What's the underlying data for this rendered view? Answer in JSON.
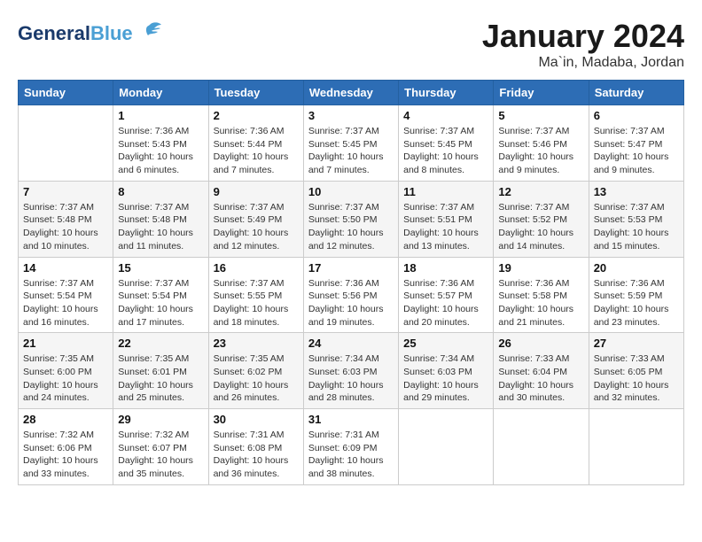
{
  "header": {
    "logo_line1": "General",
    "logo_line2": "Blue",
    "month": "January 2024",
    "location": "Ma`in, Madaba, Jordan"
  },
  "weekdays": [
    "Sunday",
    "Monday",
    "Tuesday",
    "Wednesday",
    "Thursday",
    "Friday",
    "Saturday"
  ],
  "weeks": [
    [
      {
        "day": "",
        "info": ""
      },
      {
        "day": "1",
        "info": "Sunrise: 7:36 AM\nSunset: 5:43 PM\nDaylight: 10 hours\nand 6 minutes."
      },
      {
        "day": "2",
        "info": "Sunrise: 7:36 AM\nSunset: 5:44 PM\nDaylight: 10 hours\nand 7 minutes."
      },
      {
        "day": "3",
        "info": "Sunrise: 7:37 AM\nSunset: 5:45 PM\nDaylight: 10 hours\nand 7 minutes."
      },
      {
        "day": "4",
        "info": "Sunrise: 7:37 AM\nSunset: 5:45 PM\nDaylight: 10 hours\nand 8 minutes."
      },
      {
        "day": "5",
        "info": "Sunrise: 7:37 AM\nSunset: 5:46 PM\nDaylight: 10 hours\nand 9 minutes."
      },
      {
        "day": "6",
        "info": "Sunrise: 7:37 AM\nSunset: 5:47 PM\nDaylight: 10 hours\nand 9 minutes."
      }
    ],
    [
      {
        "day": "7",
        "info": "Sunrise: 7:37 AM\nSunset: 5:48 PM\nDaylight: 10 hours\nand 10 minutes."
      },
      {
        "day": "8",
        "info": "Sunrise: 7:37 AM\nSunset: 5:48 PM\nDaylight: 10 hours\nand 11 minutes."
      },
      {
        "day": "9",
        "info": "Sunrise: 7:37 AM\nSunset: 5:49 PM\nDaylight: 10 hours\nand 12 minutes."
      },
      {
        "day": "10",
        "info": "Sunrise: 7:37 AM\nSunset: 5:50 PM\nDaylight: 10 hours\nand 12 minutes."
      },
      {
        "day": "11",
        "info": "Sunrise: 7:37 AM\nSunset: 5:51 PM\nDaylight: 10 hours\nand 13 minutes."
      },
      {
        "day": "12",
        "info": "Sunrise: 7:37 AM\nSunset: 5:52 PM\nDaylight: 10 hours\nand 14 minutes."
      },
      {
        "day": "13",
        "info": "Sunrise: 7:37 AM\nSunset: 5:53 PM\nDaylight: 10 hours\nand 15 minutes."
      }
    ],
    [
      {
        "day": "14",
        "info": "Sunrise: 7:37 AM\nSunset: 5:54 PM\nDaylight: 10 hours\nand 16 minutes."
      },
      {
        "day": "15",
        "info": "Sunrise: 7:37 AM\nSunset: 5:54 PM\nDaylight: 10 hours\nand 17 minutes."
      },
      {
        "day": "16",
        "info": "Sunrise: 7:37 AM\nSunset: 5:55 PM\nDaylight: 10 hours\nand 18 minutes."
      },
      {
        "day": "17",
        "info": "Sunrise: 7:36 AM\nSunset: 5:56 PM\nDaylight: 10 hours\nand 19 minutes."
      },
      {
        "day": "18",
        "info": "Sunrise: 7:36 AM\nSunset: 5:57 PM\nDaylight: 10 hours\nand 20 minutes."
      },
      {
        "day": "19",
        "info": "Sunrise: 7:36 AM\nSunset: 5:58 PM\nDaylight: 10 hours\nand 21 minutes."
      },
      {
        "day": "20",
        "info": "Sunrise: 7:36 AM\nSunset: 5:59 PM\nDaylight: 10 hours\nand 23 minutes."
      }
    ],
    [
      {
        "day": "21",
        "info": "Sunrise: 7:35 AM\nSunset: 6:00 PM\nDaylight: 10 hours\nand 24 minutes."
      },
      {
        "day": "22",
        "info": "Sunrise: 7:35 AM\nSunset: 6:01 PM\nDaylight: 10 hours\nand 25 minutes."
      },
      {
        "day": "23",
        "info": "Sunrise: 7:35 AM\nSunset: 6:02 PM\nDaylight: 10 hours\nand 26 minutes."
      },
      {
        "day": "24",
        "info": "Sunrise: 7:34 AM\nSunset: 6:03 PM\nDaylight: 10 hours\nand 28 minutes."
      },
      {
        "day": "25",
        "info": "Sunrise: 7:34 AM\nSunset: 6:03 PM\nDaylight: 10 hours\nand 29 minutes."
      },
      {
        "day": "26",
        "info": "Sunrise: 7:33 AM\nSunset: 6:04 PM\nDaylight: 10 hours\nand 30 minutes."
      },
      {
        "day": "27",
        "info": "Sunrise: 7:33 AM\nSunset: 6:05 PM\nDaylight: 10 hours\nand 32 minutes."
      }
    ],
    [
      {
        "day": "28",
        "info": "Sunrise: 7:32 AM\nSunset: 6:06 PM\nDaylight: 10 hours\nand 33 minutes."
      },
      {
        "day": "29",
        "info": "Sunrise: 7:32 AM\nSunset: 6:07 PM\nDaylight: 10 hours\nand 35 minutes."
      },
      {
        "day": "30",
        "info": "Sunrise: 7:31 AM\nSunset: 6:08 PM\nDaylight: 10 hours\nand 36 minutes."
      },
      {
        "day": "31",
        "info": "Sunrise: 7:31 AM\nSunset: 6:09 PM\nDaylight: 10 hours\nand 38 minutes."
      },
      {
        "day": "",
        "info": ""
      },
      {
        "day": "",
        "info": ""
      },
      {
        "day": "",
        "info": ""
      }
    ]
  ]
}
